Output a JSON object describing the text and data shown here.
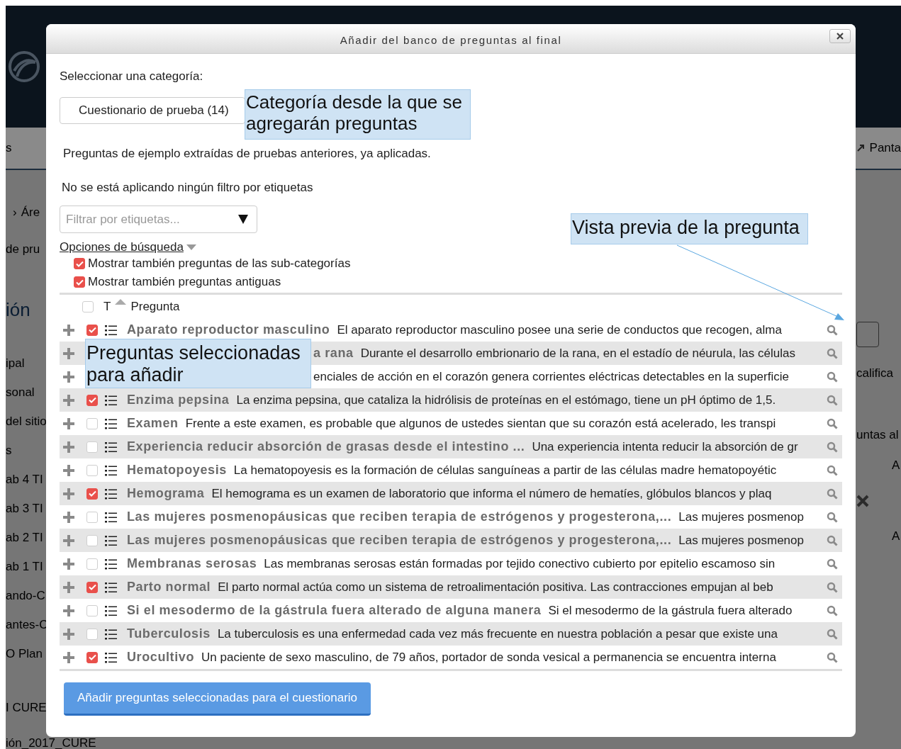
{
  "background": {
    "nav_left": "s",
    "breadcrumb_separator": "›",
    "breadcrumb": "Áre",
    "subtitle": "de pru",
    "heading": "ión",
    "sidebar_items": [
      "ipal",
      "sonal",
      "del sitio",
      "s",
      "ab 4 TI",
      "ab 3 TI",
      "ab 2 TI",
      "ab 1 TI",
      "ando-C",
      "antes-C",
      "O Plan"
    ],
    "footer_items": [
      "I CURE",
      "ión_2017_CURE"
    ],
    "nav_right": "Panta",
    "right_texts": [
      "califica",
      "untas al",
      "A",
      "A"
    ]
  },
  "dialog": {
    "title": "Añadir del banco de preguntas al final",
    "category_label": "Seleccionar una categoría:",
    "category_value": "Cuestionario de prueba (14)",
    "category_info": "Preguntas de ejemplo extraídas de pruebas anteriores, ya aplicadas.",
    "tag_status": "No se está aplicando ningún filtro por etiquetas",
    "tag_filter": {
      "placeholder": "Filtrar por etiquetas..."
    },
    "search_options": "Opciones de búsqueda",
    "options": [
      {
        "label": "Mostrar también preguntas de las sub-categorías",
        "checked": true
      },
      {
        "label": "Mostrar también preguntas antiguas",
        "checked": true
      }
    ],
    "table": {
      "header_checked": false,
      "type_column": "T",
      "question_column": "Pregunta",
      "rows": [
        {
          "name": "Aparato reproductor masculino",
          "text": "El aparato reproductor masculino posee una serie de conductos que recogen, alma",
          "checked": true
        },
        {
          "name": "a rana",
          "text": "Durante el desarrollo embrionario de la rana, en el estadío de néurula, las células"
        },
        {
          "text": "enciales de acción en el corazón genera corrientes eléctricas detectables en la superficie"
        },
        {
          "name": "Enzima pepsina",
          "text": "La enzima pepsina, que cataliza la hidrólisis de proteínas en el estómago, tiene un pH óptimo de 1,5.",
          "checked": true
        },
        {
          "name": "Examen",
          "text": "Frente a este examen, es probable que algunos de ustedes sientan que su corazón está acelerado, les transpi",
          "checked": false
        },
        {
          "name": "Experiencia reducir absorción de grasas desde el intestino ...",
          "text": "Una experiencia intenta reducir la absorción de gr",
          "checked": false
        },
        {
          "name": "Hematopoyesis",
          "text": "La hematopoyesis es la formación de células sanguíneas a partir de las células madre hematopoyétic",
          "checked": false
        },
        {
          "name": "Hemograma",
          "text": "El hemograma es un examen de laboratorio que informa el número de hematíes, glóbulos blancos y plaq",
          "checked": true
        },
        {
          "name": "Las mujeres posmenopáusicas que reciben terapia de estrógenos y progesterona,...",
          "text": "Las mujeres posmenop",
          "checked": false
        },
        {
          "name": "Las mujeres posmenopáusicas que reciben terapia de estrógenos y progesterona,...",
          "text": "Las mujeres posmenop",
          "checked": false
        },
        {
          "name": "Membranas serosas",
          "text": "Las membranas serosas están formadas por tejido conectivo cubierto por epitelio escamoso sin",
          "checked": false
        },
        {
          "name": "Parto normal",
          "text": "El parto normal actúa como un sistema de retroalimentación positiva. Las contracciones empujan al beb",
          "checked": true
        },
        {
          "name": "Si el mesodermo de la gástrula fuera alterado de alguna manera",
          "text": "Si el mesodermo de la gástrula fuera alterado",
          "checked": false
        },
        {
          "name": "Tuberculosis",
          "text": "La tuberculosis es una enfermedad cada vez más frecuente en nuestra población a pesar que existe una",
          "checked": false
        },
        {
          "name": "Urocultivo",
          "text": "Un paciente de sexo masculino, de 79 años, portador de sonda vesical a permanencia se encuentra interna",
          "checked": true
        }
      ]
    },
    "add_button": "Añadir preguntas seleccionadas para el cuestionario"
  },
  "annotations": [
    "Categoría desde la que se agregarán preguntas",
    "Vista previa de la pregunta",
    "Preguntas seleccionadas para añadir"
  ]
}
